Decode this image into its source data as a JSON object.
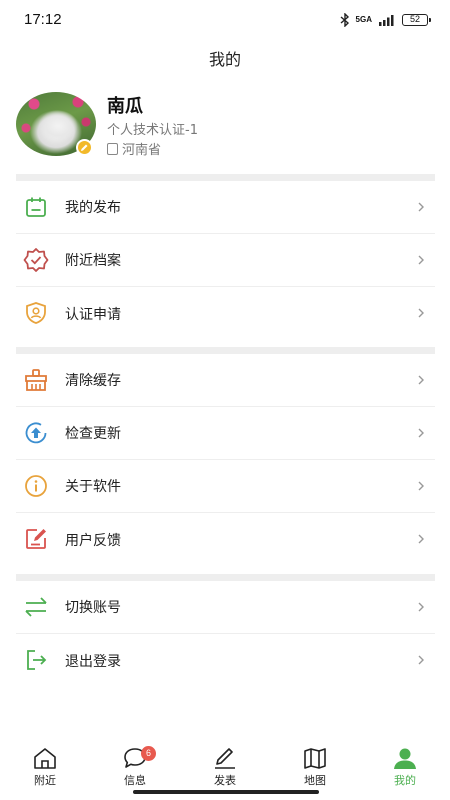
{
  "status_bar": {
    "time": "17:12",
    "network": "5GA",
    "battery": "52"
  },
  "page": {
    "title": "我的"
  },
  "profile": {
    "name": "南瓜",
    "certification": "个人技术认证-1",
    "location": "河南省"
  },
  "menu_groups": [
    {
      "items": [
        {
          "label": "我的发布",
          "icon": "calendar-icon",
          "color": "#4caf50"
        },
        {
          "label": "附近档案",
          "icon": "badge-check-icon",
          "color": "#c0504d"
        },
        {
          "label": "认证申请",
          "icon": "shield-user-icon",
          "color": "#e8a33d"
        }
      ]
    },
    {
      "items": [
        {
          "label": "清除缓存",
          "icon": "broom-icon",
          "color": "#e07b39"
        },
        {
          "label": "检查更新",
          "icon": "upload-circle-icon",
          "color": "#3b8ed0"
        },
        {
          "label": "关于软件",
          "icon": "info-circle-icon",
          "color": "#e8a33d"
        },
        {
          "label": "用户反馈",
          "icon": "feedback-edit-icon",
          "color": "#d9534f"
        }
      ]
    },
    {
      "items": [
        {
          "label": "切换账号",
          "icon": "swap-arrows-icon",
          "color": "#4caf50"
        },
        {
          "label": "退出登录",
          "icon": "logout-icon",
          "color": "#4caf50"
        }
      ]
    }
  ],
  "bottom_nav": [
    {
      "label": "附近",
      "icon": "home-icon",
      "active": false
    },
    {
      "label": "信息",
      "icon": "message-icon",
      "badge": "6",
      "active": false
    },
    {
      "label": "发表",
      "icon": "pen-icon",
      "active": false
    },
    {
      "label": "地图",
      "icon": "map-icon",
      "active": false
    },
    {
      "label": "我的",
      "icon": "user-icon",
      "active": true
    }
  ],
  "colors": {
    "accent": "#4caf50",
    "divider": "#eeeeee",
    "badge": "#e85a4f"
  }
}
